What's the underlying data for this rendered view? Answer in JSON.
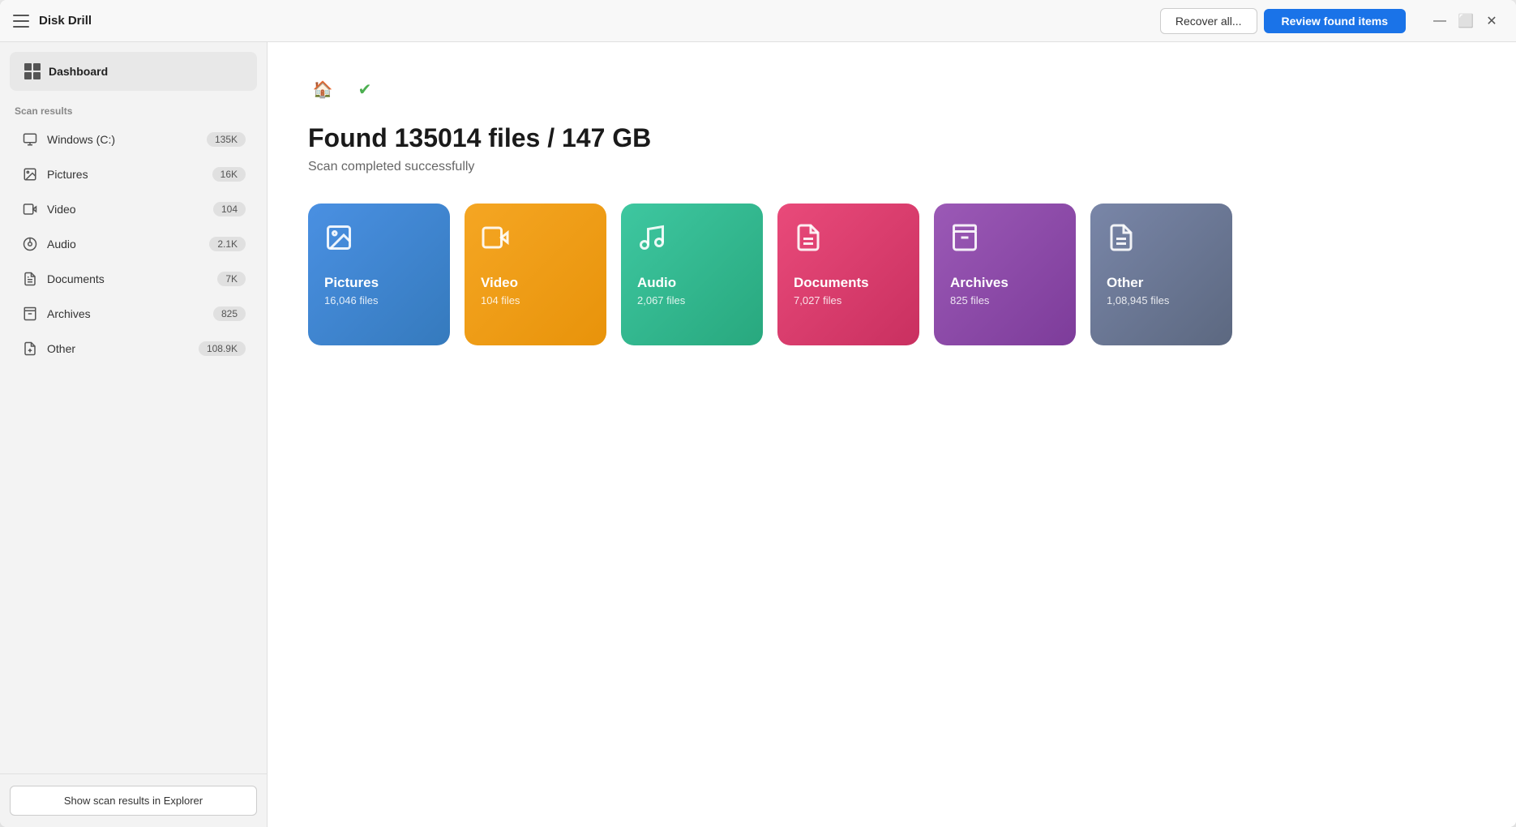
{
  "app": {
    "title": "Disk Drill"
  },
  "titlebar": {
    "recover_all_label": "Recover all...",
    "review_found_label": "Review found items",
    "minimize_label": "—",
    "maximize_label": "⬜",
    "close_label": "✕"
  },
  "toolbar": {
    "home_icon": "🏠",
    "check_icon": "✔"
  },
  "sidebar": {
    "dashboard_label": "Dashboard",
    "scan_results_title": "Scan results",
    "items": [
      {
        "id": "windows-c",
        "label": "Windows (C:)",
        "badge": "135K",
        "icon": "💾"
      },
      {
        "id": "pictures",
        "label": "Pictures",
        "badge": "16K",
        "icon": "🖼"
      },
      {
        "id": "video",
        "label": "Video",
        "badge": "104",
        "icon": "🎬"
      },
      {
        "id": "audio",
        "label": "Audio",
        "badge": "2.1K",
        "icon": "🎵"
      },
      {
        "id": "documents",
        "label": "Documents",
        "badge": "7K",
        "icon": "📄"
      },
      {
        "id": "archives",
        "label": "Archives",
        "badge": "825",
        "icon": "🗜"
      },
      {
        "id": "other",
        "label": "Other",
        "badge": "108.9K",
        "icon": "📋"
      }
    ],
    "footer_btn": "Show scan results in Explorer"
  },
  "main": {
    "page_title": "Found 135014 files / 147 GB",
    "page_subtitle": "Scan completed successfully",
    "categories": [
      {
        "id": "pictures",
        "name": "Pictures",
        "count": "16,046 files",
        "icon": "🖼",
        "class": "card-pictures"
      },
      {
        "id": "video",
        "name": "Video",
        "count": "104 files",
        "icon": "🎬",
        "class": "card-video"
      },
      {
        "id": "audio",
        "name": "Audio",
        "count": "2,067 files",
        "icon": "🎵",
        "class": "card-audio"
      },
      {
        "id": "documents",
        "name": "Documents",
        "count": "7,027 files",
        "icon": "📄",
        "class": "card-documents"
      },
      {
        "id": "archives",
        "name": "Archives",
        "count": "825 files",
        "icon": "🗜",
        "class": "card-archives"
      },
      {
        "id": "other",
        "name": "Other",
        "count": "1,08,945 files",
        "icon": "📋",
        "class": "card-other"
      }
    ]
  }
}
